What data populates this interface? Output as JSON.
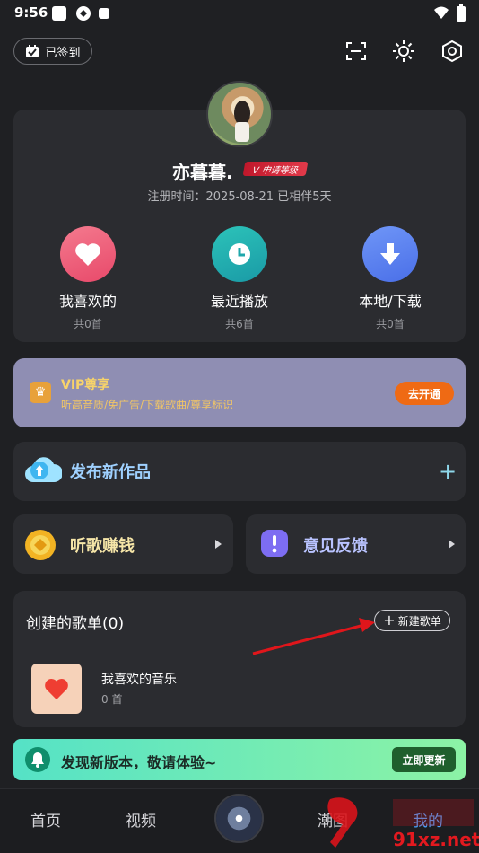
{
  "status_bar": {
    "time": "9:56"
  },
  "header": {
    "checkin_label": "已签到",
    "icons": [
      "scan-icon",
      "sun-icon",
      "settings-hex-icon"
    ]
  },
  "profile": {
    "nickname": "亦暮暮.",
    "level_badge": "V 申请等级",
    "register_info": "注册时间：2025-08-21 已相伴5天"
  },
  "quick_actions": [
    {
      "label": "我喜欢的",
      "count": "共0首",
      "color": "#f0607a",
      "icon": "heart-icon"
    },
    {
      "label": "最近播放",
      "count": "共6首",
      "color": "#23b3b0",
      "icon": "clock-icon"
    },
    {
      "label": "本地/下载",
      "count": "共0首",
      "color": "#5b84f3",
      "icon": "download-icon"
    }
  ],
  "vip": {
    "title": "VIP尊享",
    "desc": "听高音质/免广告/下载歌曲/尊享标识",
    "button": "去开通"
  },
  "publish": {
    "title": "发布新作品"
  },
  "earn": {
    "label": "听歌赚钱"
  },
  "feedback": {
    "label": "意见反馈"
  },
  "playlists": {
    "title": "创建的歌单(0)",
    "new_button": "新建歌单",
    "items": [
      {
        "name": "我喜欢的音乐",
        "count": "0 首"
      }
    ]
  },
  "update_banner": {
    "text": "发现新版本，敬请体验~",
    "button": "立即更新"
  },
  "tabbar": {
    "tabs": [
      "首页",
      "视频",
      "潮图",
      "我的"
    ],
    "active": "我的"
  },
  "watermark": {
    "text": "91xz.net"
  }
}
